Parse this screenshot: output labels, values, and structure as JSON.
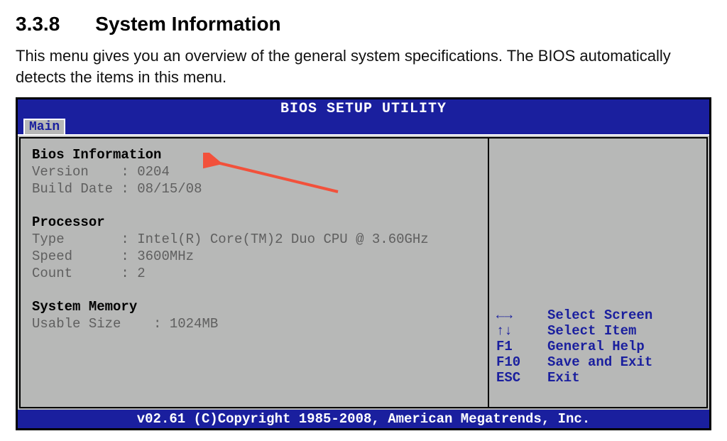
{
  "doc": {
    "section_number": "3.3.8",
    "section_title": "System Information",
    "body_text": "This menu gives you an overview of the general system specifications. The BIOS automatically detects the items in this menu."
  },
  "bios": {
    "header_title": "BIOS SETUP UTILITY",
    "tab_main": "Main",
    "sections": {
      "bios_info": {
        "title": "Bios Information",
        "version_label": "Version",
        "version_value": "0204",
        "build_date_label": "Build Date",
        "build_date_value": "08/15/08"
      },
      "processor": {
        "title": "Processor",
        "type_label": "Type",
        "type_value": "Intel(R) Core(TM)2 Duo CPU @ 3.60GHz",
        "speed_label": "Speed",
        "speed_value": "3600MHz",
        "count_label": "Count",
        "count_value": "2"
      },
      "memory": {
        "title": "System Memory",
        "usable_label": "Usable Size",
        "usable_value": "1024MB"
      }
    },
    "hints": {
      "select_screen_key": "←→",
      "select_screen_label": "Select Screen",
      "select_item_key": "↑↓",
      "select_item_label": "Select Item",
      "help_key": "F1",
      "help_label": "General Help",
      "save_key": "F10",
      "save_label": "Save and Exit",
      "exit_key": "ESC",
      "exit_label": "Exit"
    },
    "footer": "v02.61 (C)Copyright 1985-2008, American Megatrends, Inc."
  }
}
